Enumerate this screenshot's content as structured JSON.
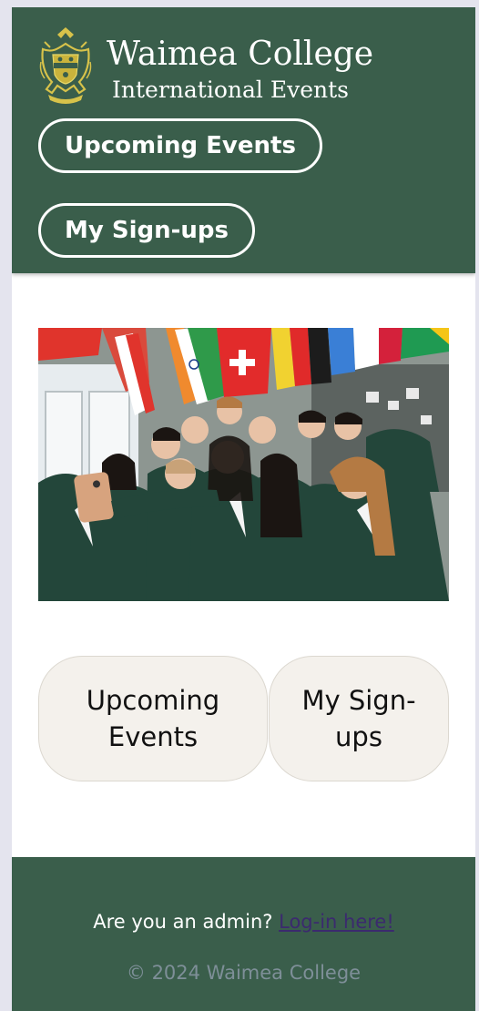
{
  "header": {
    "title": "Waimea College",
    "subtitle": "International Events",
    "logo_icon": "school-crest-icon",
    "nav": {
      "upcoming_label": "Upcoming Events",
      "signups_label": "My Sign-ups"
    }
  },
  "hero": {
    "image_kind": "photo"
  },
  "cards": {
    "upcoming": {
      "line1": "Upcoming",
      "line2": "Events"
    },
    "signups": {
      "line1": "My Sign-",
      "line2": "ups"
    }
  },
  "footer": {
    "admin_prompt": "Are you an admin?",
    "admin_link": "Log-in here!",
    "copyright": "© 2024 Waimea College"
  },
  "colors": {
    "brand_green": "#3a5e4b",
    "card_bg": "#f4f1ec",
    "link": "#3b2a6e",
    "copyright": "#7e8f98"
  }
}
